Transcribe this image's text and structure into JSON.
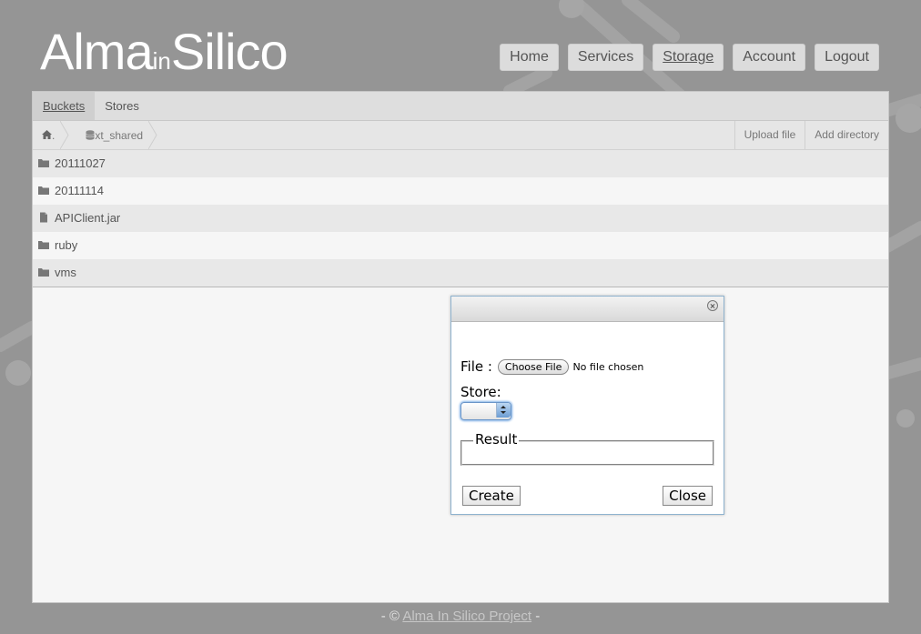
{
  "logo": {
    "part1": "Alma",
    "part2": "in",
    "part3": "Silico"
  },
  "nav": [
    {
      "label": "Home",
      "active": false
    },
    {
      "label": "Services",
      "active": false
    },
    {
      "label": "Storage",
      "active": true
    },
    {
      "label": "Account",
      "active": false
    },
    {
      "label": "Logout",
      "active": false
    }
  ],
  "tabs": [
    {
      "label": "Buckets",
      "active": true
    },
    {
      "label": "Stores",
      "active": false
    }
  ],
  "breadcrumb": {
    "home_suffix": ".",
    "bucket": "xt_shared"
  },
  "actions": {
    "upload": "Upload file",
    "add_dir": "Add directory"
  },
  "files": [
    {
      "name": "20111027",
      "type": "folder"
    },
    {
      "name": "20111114",
      "type": "folder"
    },
    {
      "name": "APIClient.jar",
      "type": "file"
    },
    {
      "name": "ruby",
      "type": "folder"
    },
    {
      "name": "vms",
      "type": "folder"
    }
  ],
  "dialog": {
    "file_label": "File :",
    "choose_label": "Choose File",
    "no_file": "No file chosen",
    "store_label": "Store:",
    "store_value": "",
    "result_label": "Result",
    "create_label": "Create",
    "close_label": "Close"
  },
  "footer": {
    "prefix": "- ©",
    "link": "Alma In Silico Project",
    "suffix": "-"
  },
  "colors": {
    "background": "#959595",
    "panel": "#f6f6f6",
    "accent": "#7fb0e6"
  }
}
